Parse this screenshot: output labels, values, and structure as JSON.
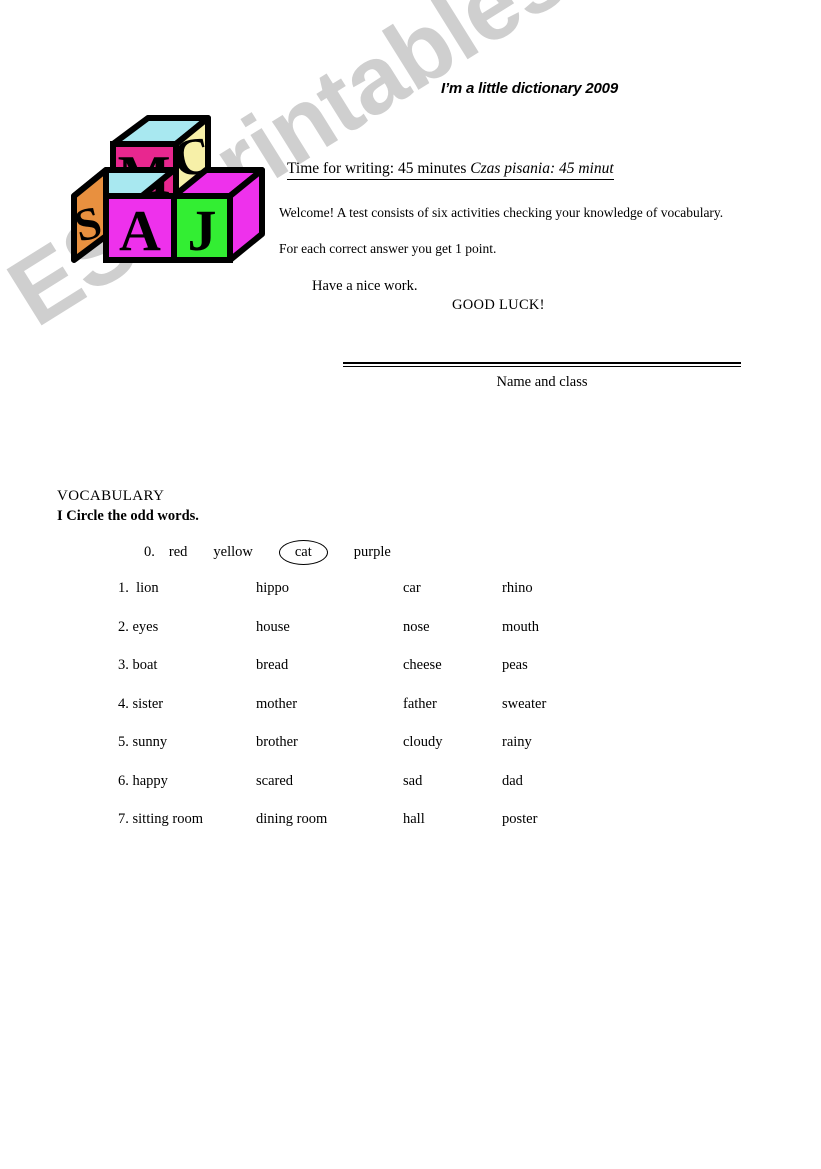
{
  "watermark": {
    "text": "ESLprintables.com"
  },
  "header": {
    "title": "I’m a little dictionary 2009",
    "time_en": "Time for writing: 45 minutes ",
    "time_pl": "Czas pisania: 45 minut",
    "welcome": "Welcome! A test consists of six activities checking your knowledge of  vocabulary.",
    "points": "For each correct answer you get 1 point.",
    "nice_work": "Have a nice work.",
    "good_luck": "GOOD LUCK!",
    "name_label": "Name and class"
  },
  "logo": {
    "alt": "alphabet-blocks",
    "blocks": [
      {
        "letter": "M",
        "face": "#e8278f"
      },
      {
        "letter": "C",
        "face": "#f7f0a8"
      },
      {
        "letter": "S",
        "face": "#e8903f"
      },
      {
        "letter": "A",
        "face": "#ee31ec"
      },
      {
        "letter": "J",
        "face": "#33ee33"
      }
    ],
    "top_face_color": "#a8e8f0",
    "outline_color": "#000000"
  },
  "section": {
    "heading": "VOCABULARY",
    "task": "I Circle the odd words."
  },
  "example": {
    "number": "0.",
    "words": [
      "red",
      "yellow",
      "cat",
      "purple"
    ],
    "circled_index": 2
  },
  "rows": [
    {
      "number": "1.",
      "words": [
        "lion",
        "hippo",
        "car",
        "rhino"
      ]
    },
    {
      "number": "2.",
      "words": [
        "eyes",
        "house",
        "nose",
        "mouth"
      ]
    },
    {
      "number": "3.",
      "words": [
        "boat",
        "bread",
        "cheese",
        "peas"
      ]
    },
    {
      "number": "4.",
      "words": [
        "sister",
        "mother",
        "father",
        "sweater"
      ]
    },
    {
      "number": "5.",
      "words": [
        "sunny",
        "brother",
        "cloudy",
        "rainy"
      ]
    },
    {
      "number": "6.",
      "words": [
        "happy",
        "scared",
        "sad",
        "dad"
      ]
    },
    {
      "number": "7.",
      "words": [
        "sitting room",
        "dining room",
        "hall",
        "poster"
      ]
    }
  ]
}
